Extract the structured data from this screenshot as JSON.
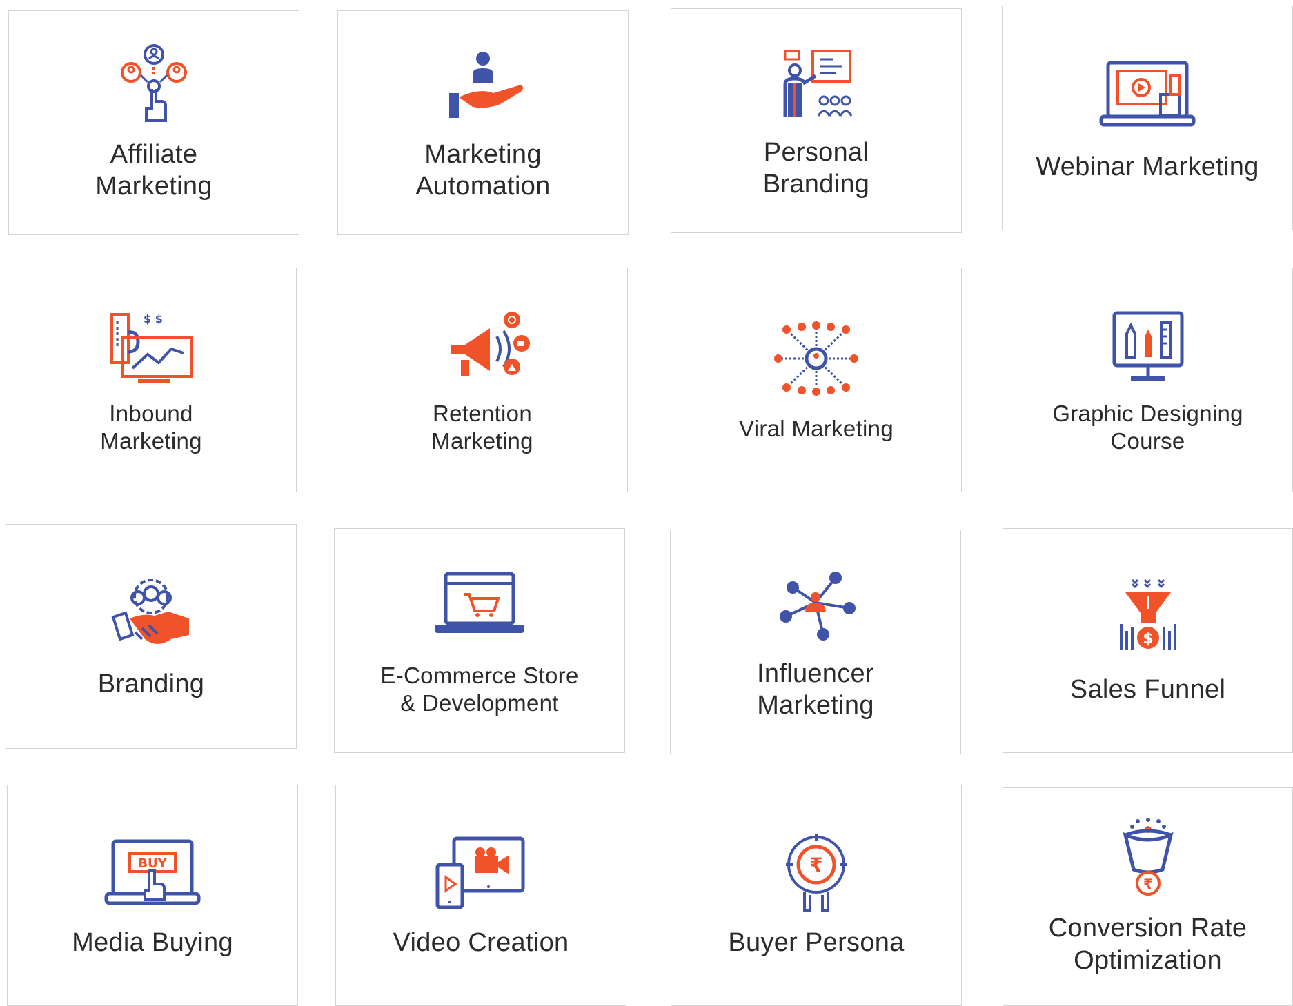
{
  "colors": {
    "blue": "#3f54a8",
    "orange": "#f0522a",
    "border": "#d4d4d4",
    "text": "#2b2b2b"
  },
  "services": [
    {
      "label": "Affiliate\nMarketing",
      "icon": "affiliate-network-icon"
    },
    {
      "label": "Marketing\nAutomation",
      "icon": "hand-user-icon"
    },
    {
      "label": "Personal\nBranding",
      "icon": "presenter-icon"
    },
    {
      "label": "Webinar Marketing",
      "icon": "webinar-laptop-icon"
    },
    {
      "label": "Inbound\nMarketing",
      "icon": "magnet-chart-icon"
    },
    {
      "label": "Retention\nMarketing",
      "icon": "megaphone-icon"
    },
    {
      "label": "Viral Marketing",
      "icon": "viral-network-icon"
    },
    {
      "label": "Graphic Designing\nCourse",
      "icon": "design-monitor-icon"
    },
    {
      "label": "Branding",
      "icon": "handshake-icon"
    },
    {
      "label": "E-Commerce Store\n& Development",
      "icon": "ecommerce-laptop-icon"
    },
    {
      "label": "Influencer\nMarketing",
      "icon": "influencer-network-icon"
    },
    {
      "label": "Sales Funnel",
      "icon": "funnel-icon"
    },
    {
      "label": "Media Buying",
      "icon": "buy-laptop-icon"
    },
    {
      "label": "Video Creation",
      "icon": "video-devices-icon"
    },
    {
      "label": "Buyer Persona",
      "icon": "rupee-target-icon"
    },
    {
      "label": "Conversion Rate\nOptimization",
      "icon": "conversion-funnel-icon"
    }
  ],
  "icon_glyphs": {
    "buy": "BUY",
    "rupee": "₹",
    "dollar": "$"
  }
}
